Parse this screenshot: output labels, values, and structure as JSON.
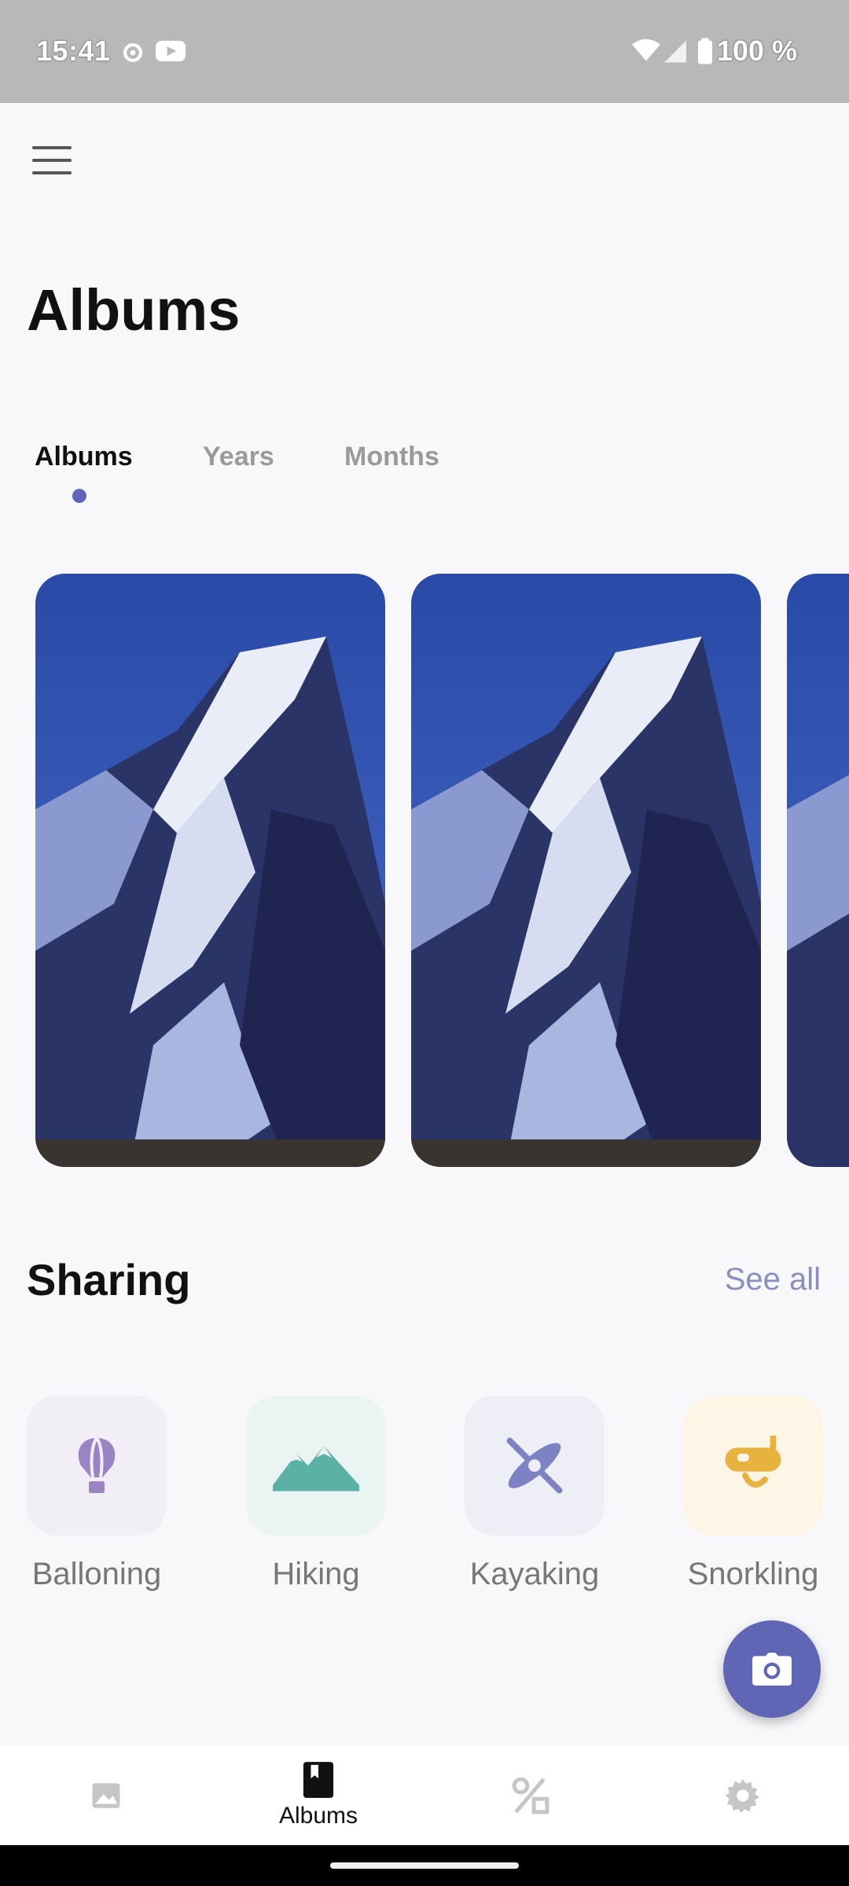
{
  "status_bar": {
    "time": "15:41",
    "battery": "100 %",
    "icons": [
      "settings-icon",
      "youtube-icon",
      "wifi-icon",
      "signal-icon",
      "battery-icon"
    ]
  },
  "header": {
    "menu_icon": "hamburger-menu-icon",
    "title": "Albums"
  },
  "tabs": [
    {
      "label": "Albums",
      "active": true
    },
    {
      "label": "Years",
      "active": false
    },
    {
      "label": "Months",
      "active": false
    }
  ],
  "albums": [
    {
      "image": "mountain-peak-photo"
    },
    {
      "image": "mountain-peak-photo"
    },
    {
      "image": "mountain-peak-photo"
    }
  ],
  "sharing": {
    "title": "Sharing",
    "see_all": "See all",
    "items": [
      {
        "label": "Balloning",
        "icon": "hot-air-balloon-icon",
        "bg": "#f1eef6",
        "color": "#9a84c4"
      },
      {
        "label": "Hiking",
        "icon": "mountains-icon",
        "bg": "#eaf4f3",
        "color": "#5bb1a5"
      },
      {
        "label": "Kayaking",
        "icon": "kayak-icon",
        "bg": "#eeeff6",
        "color": "#7d82c4"
      },
      {
        "label": "Snorkling",
        "icon": "snorkel-mask-icon",
        "bg": "#fdf6e6",
        "color": "#e8b23e"
      }
    ]
  },
  "fab": {
    "icon": "camera-icon",
    "color": "#5f66b5"
  },
  "bottom_nav": [
    {
      "icon": "photo-icon",
      "label": "",
      "active": false
    },
    {
      "icon": "albums-book-icon",
      "label": "Albums",
      "active": true
    },
    {
      "icon": "shapes-icon",
      "label": "",
      "active": false
    },
    {
      "icon": "gear-icon",
      "label": "",
      "active": false
    }
  ]
}
